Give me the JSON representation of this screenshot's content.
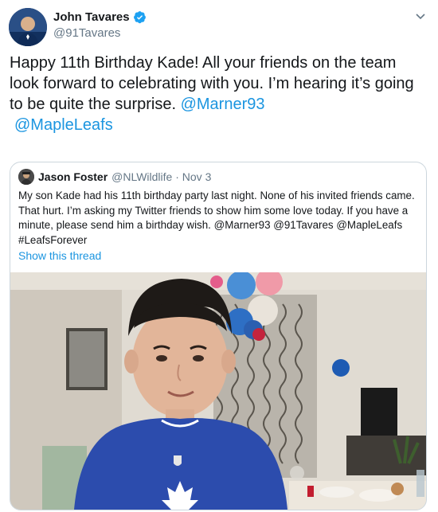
{
  "tweet": {
    "author_name": "John Tavares",
    "author_handle": "@91Tavares",
    "text_main": "Happy 11th Birthday Kade! All your friends on the team look forward to celebrating with you. I’m hearing it’s going to be quite the surprise.",
    "mentions": [
      "@Marner93",
      "@MapleLeafs"
    ]
  },
  "quoted": {
    "author_name": "Jason Foster",
    "author_handle": "@NLWildlife",
    "date": "Nov 3",
    "text": "My son Kade had his 11th birthday party last night. None of his invited friends came. That hurt. I’m asking my Twitter friends to show him some love today. If you have a minute, please send him a birthday wish. @Marner93 @91Tavares @MapleLeafs #LeafsForever",
    "show_thread": "Show this thread"
  },
  "icons": [
    "verified-badge-icon",
    "chevron-down-icon"
  ],
  "colors": {
    "link": "#1b95e0",
    "secondary": "#657786",
    "border": "#ccd6dd",
    "leafs_blue": "#00205b"
  }
}
